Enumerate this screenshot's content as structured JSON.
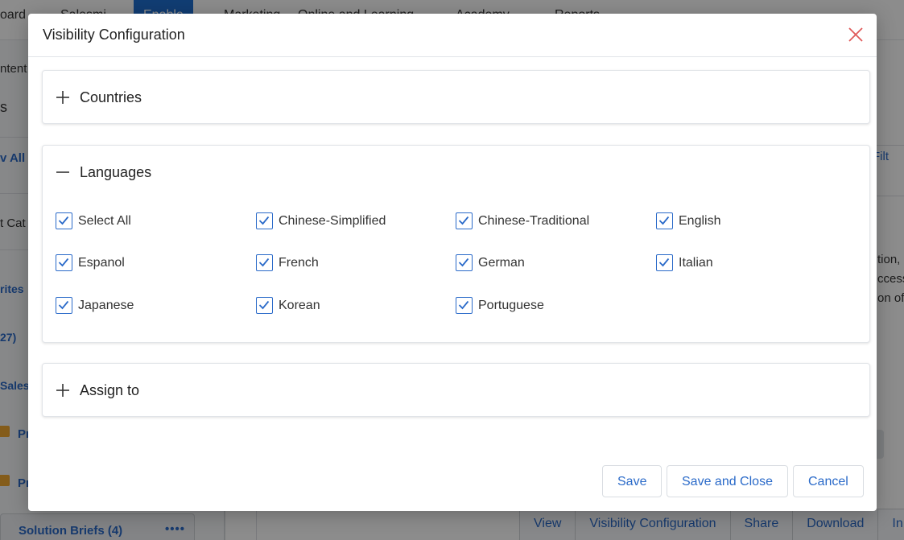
{
  "background": {
    "nav": [
      "oard",
      "Salesmi",
      "Enable",
      "Marketing",
      "Online and Learning",
      "Academy",
      "Reports"
    ],
    "sidebar_texts": [
      "ntent",
      "s",
      "v All",
      "t Cat",
      "rites",
      "27)",
      "Sales",
      "Pr",
      "Pr"
    ],
    "solution_briefs": "Solution Briefs (4)",
    "solution_briefs_more": "••••",
    "filter_fragment": "Filt",
    "body_fragments": [
      "tion,",
      "ccess",
      "on of"
    ],
    "actions": [
      "View",
      "Visibility Configuration",
      "Share",
      "Download",
      "In"
    ]
  },
  "modal": {
    "title": "Visibility Configuration",
    "panels": {
      "countries": {
        "title": "Countries",
        "state": "collapsed"
      },
      "languages": {
        "title": "Languages",
        "state": "expanded",
        "options": [
          {
            "label": "Select All",
            "checked": true
          },
          {
            "label": "Chinese-Simplified",
            "checked": true
          },
          {
            "label": "Chinese-Traditional",
            "checked": true
          },
          {
            "label": "English",
            "checked": true
          },
          {
            "label": "Espanol",
            "checked": true
          },
          {
            "label": "French",
            "checked": true
          },
          {
            "label": "German",
            "checked": true
          },
          {
            "label": "Italian",
            "checked": true
          },
          {
            "label": "Japanese",
            "checked": true
          },
          {
            "label": "Korean",
            "checked": true
          },
          {
            "label": "Portuguese",
            "checked": true
          }
        ]
      },
      "assign_to": {
        "title": "Assign to",
        "state": "collapsed"
      }
    },
    "buttons": {
      "save": "Save",
      "save_and_close": "Save and Close",
      "cancel": "Cancel"
    }
  },
  "colors": {
    "accent": "#2a6ac9",
    "close": "#e05a5a",
    "overlay": "rgba(0,0,0,0.45)"
  },
  "icons": {
    "close": "close-icon",
    "expand": "plus-icon",
    "collapse": "minus-icon",
    "check": "check-icon",
    "folder": "folder-icon"
  }
}
